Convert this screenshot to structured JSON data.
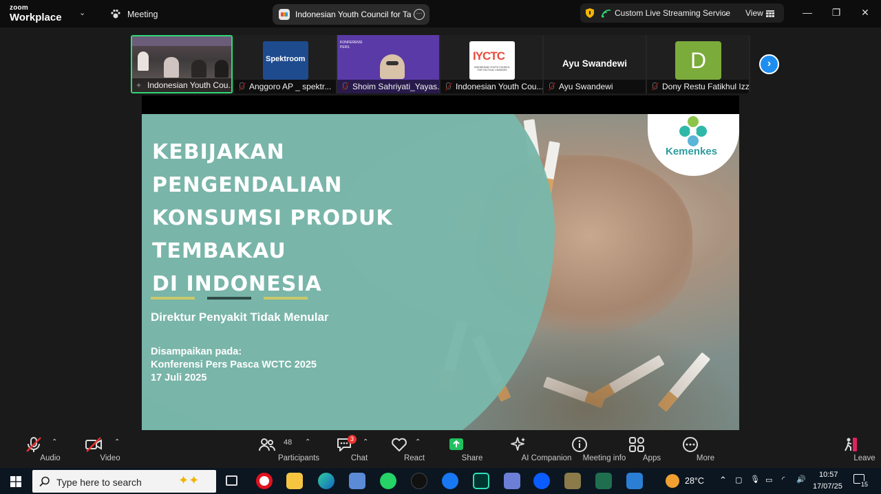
{
  "app": {
    "logo_small": "zoom",
    "logo_big": "Workplace"
  },
  "titlebar": {
    "meeting_label": "Meeting",
    "tab_title": "Indonesian Youth Council for Tact",
    "stream_label": "Custom Live Streaming Service",
    "view_label": "View"
  },
  "gallery": [
    {
      "name": "Indonesian Youth Cou...",
      "muted": false,
      "pinned": true
    },
    {
      "name": "Anggoro AP _ spektr...",
      "muted": true,
      "thumb_text": "Spektroom"
    },
    {
      "name": "Shoim Sahriyati_Yayas...",
      "muted": true,
      "thumb_text": "KONFERENSI PERS"
    },
    {
      "name": "Indonesian Youth Cou...",
      "muted": true,
      "thumb_text": "IYCTC",
      "thumb_sub": "INDONESIAN YOUTH COUNCIL FOR TACTICAL CHANGES"
    },
    {
      "name": "Ayu Swandewi",
      "muted": true,
      "thumb_text": "Ayu Swandewi"
    },
    {
      "name": "Dony Restu Fatikhul Izzi",
      "muted": true,
      "thumb_text": "D"
    }
  ],
  "slide": {
    "title_lines": [
      "KEBIJAKAN",
      "PENGENDALIAN",
      "KONSUMSI PRODUK",
      "TEMBAKAU",
      "DI INDONESIA"
    ],
    "subtitle": "Direktur Penyakit Tidak Menular",
    "delivered_lines": [
      "Disampaikan pada:",
      "Konferensi Pers Pasca WCTC 2025",
      "17 Juli 2025"
    ],
    "logo_text": "Kemenkes",
    "dash_colors": [
      "#c9c86a",
      "#2f4a45",
      "#c9c86a"
    ]
  },
  "toolbar": {
    "audio": "Audio",
    "video": "Video",
    "participants": "Participants",
    "participants_count": "48",
    "chat": "Chat",
    "chat_badge": "3",
    "react": "React",
    "share": "Share",
    "ai_companion": "AI Companion",
    "meeting_info": "Meeting info",
    "apps": "Apps",
    "more": "More",
    "leave": "Leave"
  },
  "taskbar": {
    "search_placeholder": "Type here to search",
    "temperature": "28°C",
    "time": "10:57",
    "date": "17/07/25",
    "notif_count": "15"
  },
  "colors": {
    "share_green": "#21c15f",
    "leave_red": "#e0245e",
    "accent_blue": "#1e8df0",
    "active_tile": "#31d876"
  }
}
